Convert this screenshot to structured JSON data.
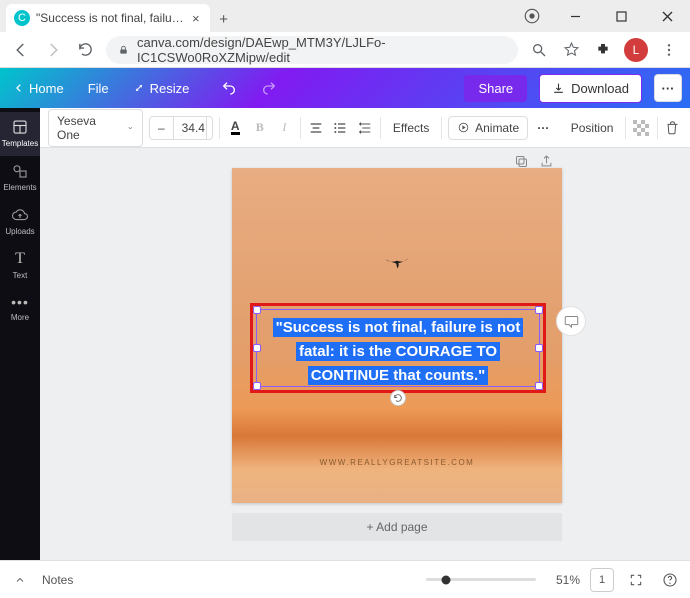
{
  "browser": {
    "tab_title": "\"Success is not final, failure is not…",
    "url": "canva.com/design/DAEwp_MTM3Y/LJLFo-IC1CSWo0RoXZMipw/edit",
    "avatar_initial": "L",
    "favicon_letter": "C"
  },
  "topbar": {
    "home": "Home",
    "file": "File",
    "resize": "Resize",
    "share": "Share",
    "download": "Download"
  },
  "sidebar": {
    "items": [
      {
        "label": "Templates"
      },
      {
        "label": "Elements"
      },
      {
        "label": "Uploads"
      },
      {
        "label": "Text"
      },
      {
        "label": "More"
      }
    ]
  },
  "toolbar": {
    "font_name": "Yeseva One",
    "font_size": "34.4",
    "effects": "Effects",
    "animate": "Animate",
    "position": "Position"
  },
  "canvas": {
    "quote": "\"Success is not final, failure is not fatal: it is the COURAGE TO CONTINUE that counts.\"",
    "site": "WWW.REALLYGREATSITE.COM",
    "add_page": "+ Add page"
  },
  "bottombar": {
    "notes": "Notes",
    "zoom": "51%",
    "page_indicator": "1"
  }
}
